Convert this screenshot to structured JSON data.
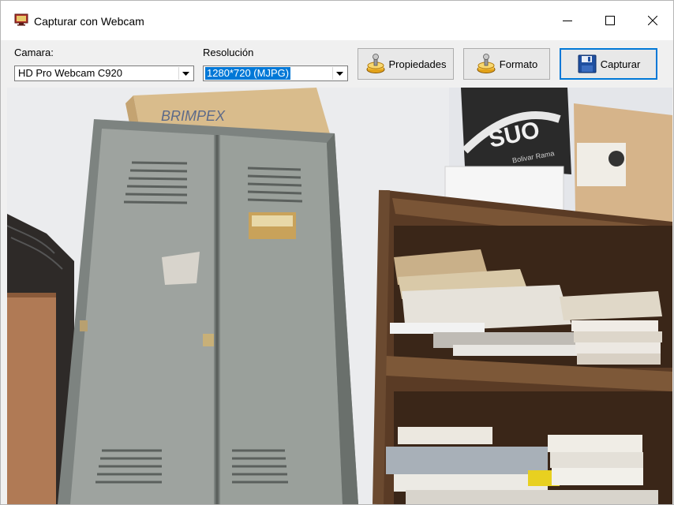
{
  "window": {
    "title": "Capturar con Webcam"
  },
  "titlebar": {
    "minimize_icon": "minimize-icon",
    "maximize_icon": "maximize-icon",
    "close_icon": "close-icon"
  },
  "toolbar": {
    "camera_label": "Camara:",
    "camera_value": "HD Pro Webcam C920",
    "resolution_label": "Resolución",
    "resolution_value": "1280*720  (MJPG)",
    "properties_label": "Propiedades",
    "format_label": "Formato",
    "capture_label": "Capturar"
  },
  "video": {
    "box_brand": "BRIMPEX",
    "box_brand_2": "SUO",
    "box_small_text": "Bolivar Rama"
  },
  "colors": {
    "titlebar_bg": "#ffffff",
    "toolbar_bg": "#f0f0f0",
    "selection_blue": "#0078d7",
    "locker_gray": "#8f9490",
    "shelf_wood": "#6b4a32",
    "wall": "#ebecef"
  }
}
